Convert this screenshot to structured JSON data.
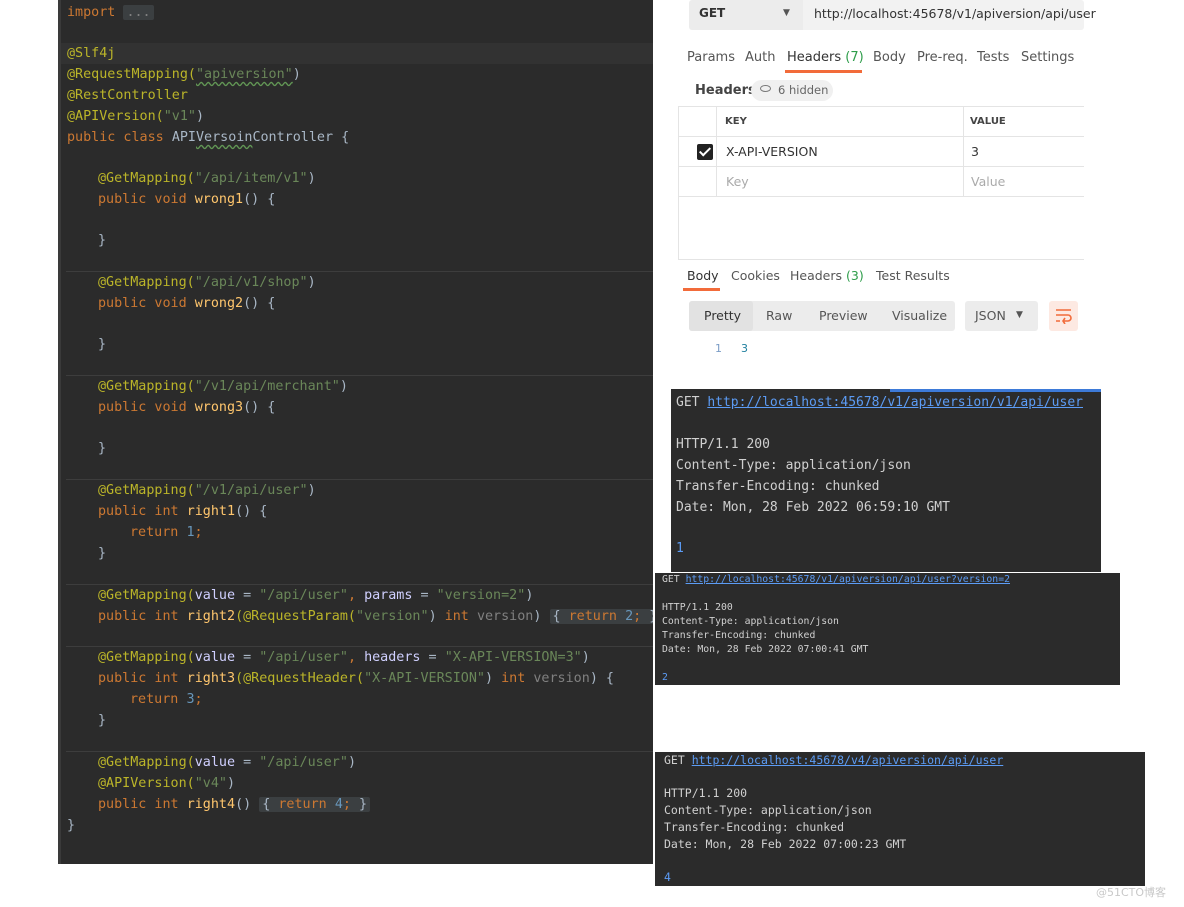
{
  "editor": {
    "lines": [
      {
        "top": 1,
        "parts": [
          [
            "kw",
            "import"
          ],
          [
            "",
            ""
          ],
          [
            "gr",
            " ..."
          ]
        ]
      }
    ]
  },
  "code": {
    "l_import_kw": "import",
    "l_import_dots": "...",
    "l_slf4j": "@Slf4j",
    "l_reqmap_a": "@RequestMapping(",
    "l_reqmap_s": "\"apiversion\"",
    "l_reqmap_b": ")",
    "l_restctrl": "@RestController",
    "l_apiver_a": "@APIVersion(",
    "l_apiver_s": "\"v1\"",
    "l_apiver_b": ")",
    "l_class_kw": "public class ",
    "l_class_name_a": "API",
    "l_class_name_b": "Versoin",
    "l_class_name_c": "Controller {",
    "g1_ann": "@GetMapping(",
    "g1_str": "\"/api/item/v1\"",
    "g1_end": ")",
    "w1_kw": "public void ",
    "w1_fn": "wrong1",
    "w1_end": "() {",
    "w1_close": "}",
    "g2_ann": "@GetMapping(",
    "g2_str": "\"/api/v1/shop\"",
    "g2_end": ")",
    "w2_kw": "public void ",
    "w2_fn": "wrong2",
    "w2_end": "() {",
    "w2_close": "}",
    "g3_ann": "@GetMapping(",
    "g3_str": "\"/v1/api/merchant\"",
    "g3_end": ")",
    "w3_kw": "public void ",
    "w3_fn": "wrong3",
    "w3_end": "() {",
    "w3_close": "}",
    "g4_ann": "@GetMapping(",
    "g4_str": "\"/v1/api/user\"",
    "g4_end": ")",
    "r1_kw": "public int ",
    "r1_fn": "right1",
    "r1_end": "() {",
    "r1_ret_kw": "return ",
    "r1_ret_num": "1",
    "r1_ret_semi": ";",
    "r1_close": "}",
    "g5_ann": "@GetMapping(",
    "g5_key1": "value",
    "g5_eq1": " = ",
    "g5_str1": "\"/api/user\"",
    "g5_comma": ", ",
    "g5_key2": "params",
    "g5_eq2": " = ",
    "g5_str2": "\"version=2\"",
    "g5_end": ")",
    "r2_kw": "public int ",
    "r2_fn": "right2",
    "r2_ann": "(@RequestParam(",
    "r2_str": "\"version\"",
    "r2_mid": ") ",
    "r2_int": "int ",
    "r2_param": "version",
    "r2_close_paren": ") ",
    "r2_fold_open": "{ ",
    "r2_ret": "return ",
    "r2_num": "2",
    "r2_semi": "; ",
    "r2_fold_close": "}",
    "g6_ann": "@GetMapping(",
    "g6_key1": "value",
    "g6_eq1": " = ",
    "g6_str1": "\"/api/user\"",
    "g6_comma": ", ",
    "g6_key2": "headers",
    "g6_eq2": " = ",
    "g6_str2": "\"X-API-VERSION=3\"",
    "g6_end": ")",
    "r3_kw": "public int ",
    "r3_fn": "right3",
    "r3_ann": "(@RequestHeader(",
    "r3_str": "\"X-API-VERSION\"",
    "r3_mid": ") ",
    "r3_int": "int ",
    "r3_param": "version",
    "r3_end": ") {",
    "r3_ret_kw": "return ",
    "r3_ret_num": "3",
    "r3_ret_semi": ";",
    "r3_close": "}",
    "g7_ann": "@GetMapping(",
    "g7_key": "value",
    "g7_eq": " = ",
    "g7_str": "\"/api/user\"",
    "g7_end": ")",
    "a7_ann": "@APIVersion(",
    "a7_str": "\"v4\"",
    "a7_end": ")",
    "r4_kw": "public int ",
    "r4_fn": "right4",
    "r4_paren": "() ",
    "r4_fold_open": "{ ",
    "r4_ret": "return ",
    "r4_num": "4",
    "r4_semi": "; ",
    "r4_fold_close": "}",
    "class_close": "}"
  },
  "postman": {
    "method": "GET",
    "url": "http://localhost:45678/v1/apiversion/api/user",
    "tabs": {
      "params": "Params",
      "auth": "Auth",
      "headers": "Headers",
      "headers_count": "(7)",
      "body": "Body",
      "prereq": "Pre-req.",
      "tests": "Tests",
      "settings": "Settings"
    },
    "headers_label": "Headers",
    "hidden_label": "6 hidden",
    "table": {
      "col_key": "KEY",
      "col_value": "VALUE",
      "row_key": "X-API-VERSION",
      "row_value": "3",
      "key_placeholder": "Key",
      "value_placeholder": "Value"
    },
    "response_tabs": {
      "body": "Body",
      "cookies": "Cookies",
      "headers": "Headers",
      "headers_count": "(3)",
      "test_results": "Test Results"
    },
    "format": {
      "pretty": "Pretty",
      "raw": "Raw",
      "preview": "Preview",
      "visualize": "Visualize",
      "type": "JSON"
    },
    "response": {
      "line_no": "1",
      "value": "3"
    }
  },
  "term1": {
    "get": "GET ",
    "url": "http://localhost:45678/v1/apiversion/v1/api/user",
    "status": "HTTP/1.1 200",
    "content_type": "Content-Type: application/json",
    "transfer": "Transfer-Encoding: chunked",
    "date": "Date: Mon, 28 Feb 2022 06:59:10 GMT",
    "body": "1"
  },
  "term2": {
    "get": "GET ",
    "url": "http://localhost:45678/v1/apiversion/api/user?version=2",
    "status": "HTTP/1.1 200",
    "content_type": "Content-Type: application/json",
    "transfer": "Transfer-Encoding: chunked",
    "date": "Date: Mon, 28 Feb 2022 07:00:41 GMT",
    "body": "2"
  },
  "term3": {
    "get": "GET ",
    "url": "http://localhost:45678/v4/apiversion/api/user",
    "status": "HTTP/1.1 200",
    "content_type": "Content-Type: application/json",
    "transfer": "Transfer-Encoding: chunked",
    "date": "Date: Mon, 28 Feb 2022 07:00:23 GMT",
    "body": "4"
  },
  "watermark": "@51CTO博客",
  "colors": {
    "accent": "#f26b3a",
    "count_green": "#2e9d4a",
    "link_blue": "#5c9cf5"
  }
}
